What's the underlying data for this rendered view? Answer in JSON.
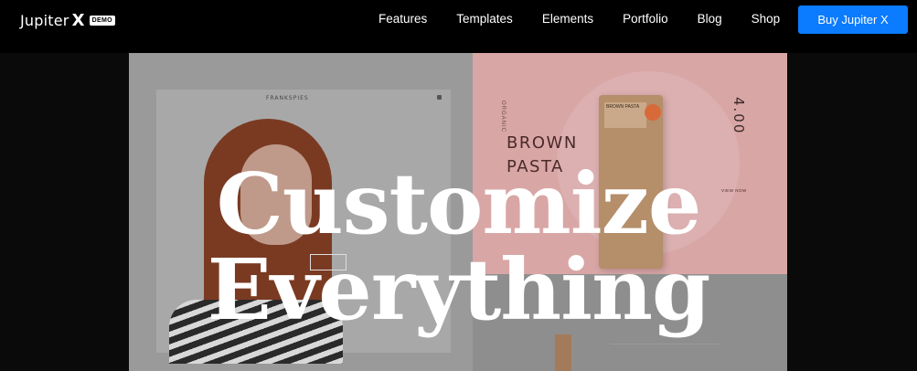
{
  "brand": {
    "name": "Jupiter",
    "name_suffix": "X",
    "badge": "DEMO"
  },
  "nav": {
    "items": [
      "Features",
      "Templates",
      "Elements",
      "Portfolio",
      "Blog",
      "Shop"
    ]
  },
  "cta": {
    "label": "Buy Jupiter X",
    "color": "#0b7bff"
  },
  "hero": {
    "headline_line1": "Customize",
    "headline_line2": "Everything",
    "preview_left": {
      "card_title": "FRANKSPIES"
    },
    "preview_right": {
      "product_line1": "BROWN",
      "product_line2": "PASTA",
      "side_label": "ORGANIC",
      "pack_label": "BROWN PASTA",
      "price": "4.00",
      "view_link": "VIEW NOW"
    }
  }
}
